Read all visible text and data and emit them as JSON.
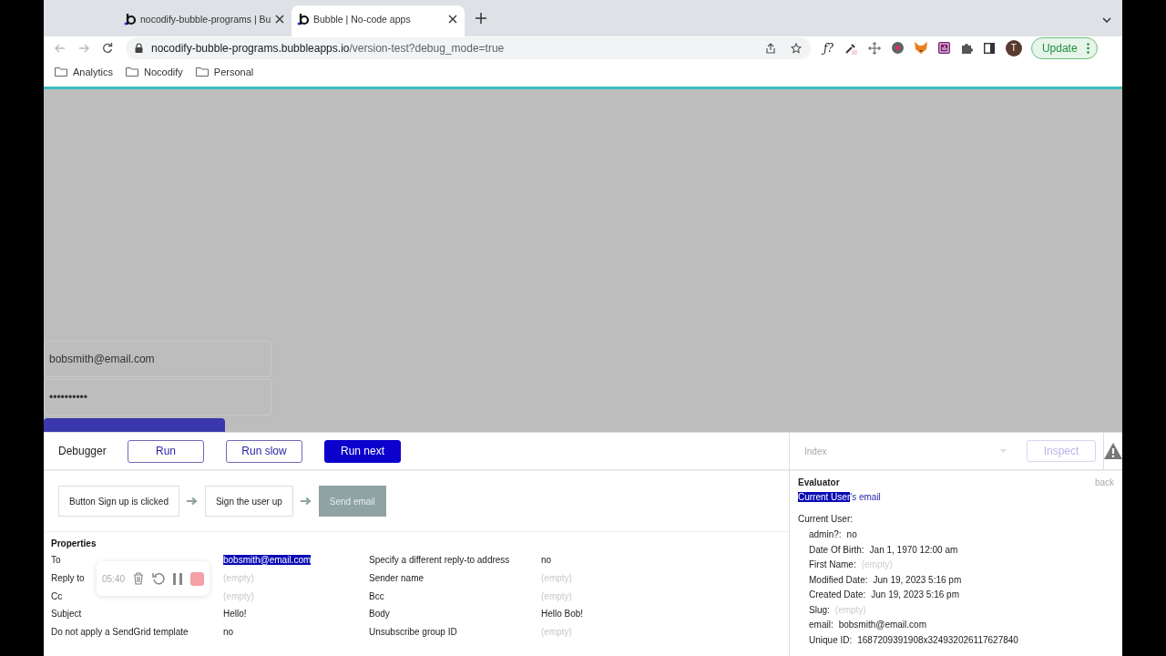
{
  "browser": {
    "tabs": [
      {
        "title": "nocodify-bubble-programs | Bu",
        "selected": false
      },
      {
        "title": "Bubble | No-code apps",
        "selected": true
      }
    ],
    "url": {
      "host": "nocodify-bubble-programs.bubbleapps.io",
      "path": "/version-test?debug_mode=true"
    },
    "extension_label": "ƒ?",
    "profile_initial": "T",
    "update_button": "Update",
    "bookmarks": [
      "Analytics",
      "Nocodify",
      "Personal"
    ]
  },
  "app": {
    "email_field": {
      "value": "bobsmith@email.com"
    },
    "password_field": {
      "value": "••••••••••"
    }
  },
  "debugger": {
    "title": "Debugger",
    "buttons": [
      {
        "label": "Run",
        "kind": "outline"
      },
      {
        "label": "Run slow",
        "kind": "outline"
      },
      {
        "label": "Run next",
        "kind": "primary"
      }
    ],
    "steps": [
      {
        "label": "Button Sign up is clicked",
        "selected": false
      },
      {
        "label": "Sign the user up",
        "selected": false
      },
      {
        "label": "Send email",
        "selected": true
      }
    ],
    "properties_title": "Properties",
    "properties": [
      [
        {
          "label": "To",
          "value": "bobsmith@email.com",
          "empty": false,
          "highlighted": true
        },
        {
          "label": "Specify a different reply-to address",
          "value": "no",
          "empty": false,
          "highlighted": false
        }
      ],
      [
        {
          "label": "Reply to",
          "value": "(empty)",
          "empty": true,
          "highlighted": false
        },
        {
          "label": "Sender name",
          "value": "(empty)",
          "empty": true,
          "highlighted": false
        }
      ],
      [
        {
          "label": "Cc",
          "value": "(empty)",
          "empty": true,
          "highlighted": false
        },
        {
          "label": "Bcc",
          "value": "(empty)",
          "empty": true,
          "highlighted": false
        }
      ],
      [
        {
          "label": "Subject",
          "value": "Hello!",
          "empty": false,
          "highlighted": false
        },
        {
          "label": "Body",
          "value": "Hello Bob!",
          "empty": false,
          "highlighted": false
        }
      ],
      [
        {
          "label": "Do not apply a SendGrid template",
          "value": "no",
          "empty": false,
          "highlighted": false
        },
        {
          "label": "Unsubscribe group ID",
          "value": "(empty)",
          "empty": true,
          "highlighted": false
        }
      ]
    ]
  },
  "evaluator": {
    "page_dropdown": {
      "placeholder": "Index"
    },
    "inspect_button": {
      "label": "Inspect",
      "disabled": true
    },
    "title": "Evaluator",
    "back_link": "back",
    "expression": [
      {
        "text": "Current User",
        "highlighted": true
      },
      {
        "text": "'s email",
        "highlighted": false
      }
    ],
    "object_title": "Current User:",
    "fields": [
      {
        "label": "admin?:",
        "value": "no",
        "empty": false
      },
      {
        "label": "Date Of Birth:",
        "value": "Jan 1, 1970 12:00 am",
        "empty": false
      },
      {
        "label": "First Name:",
        "value": "(empty)",
        "empty": true
      },
      {
        "label": "Modified Date:",
        "value": "Jun 19, 2023 5:16 pm",
        "empty": false
      },
      {
        "label": "Created Date:",
        "value": "Jun 19, 2023 5:16 pm",
        "empty": false
      },
      {
        "label": "Slug:",
        "value": "(empty)",
        "empty": true
      },
      {
        "label": "email:",
        "value": "bobsmith@email.com",
        "empty": false
      },
      {
        "label": "Unique ID:",
        "value": "1687209391908x324932026117627840",
        "empty": false
      }
    ]
  },
  "recorder": {
    "timer": "05:40"
  }
}
